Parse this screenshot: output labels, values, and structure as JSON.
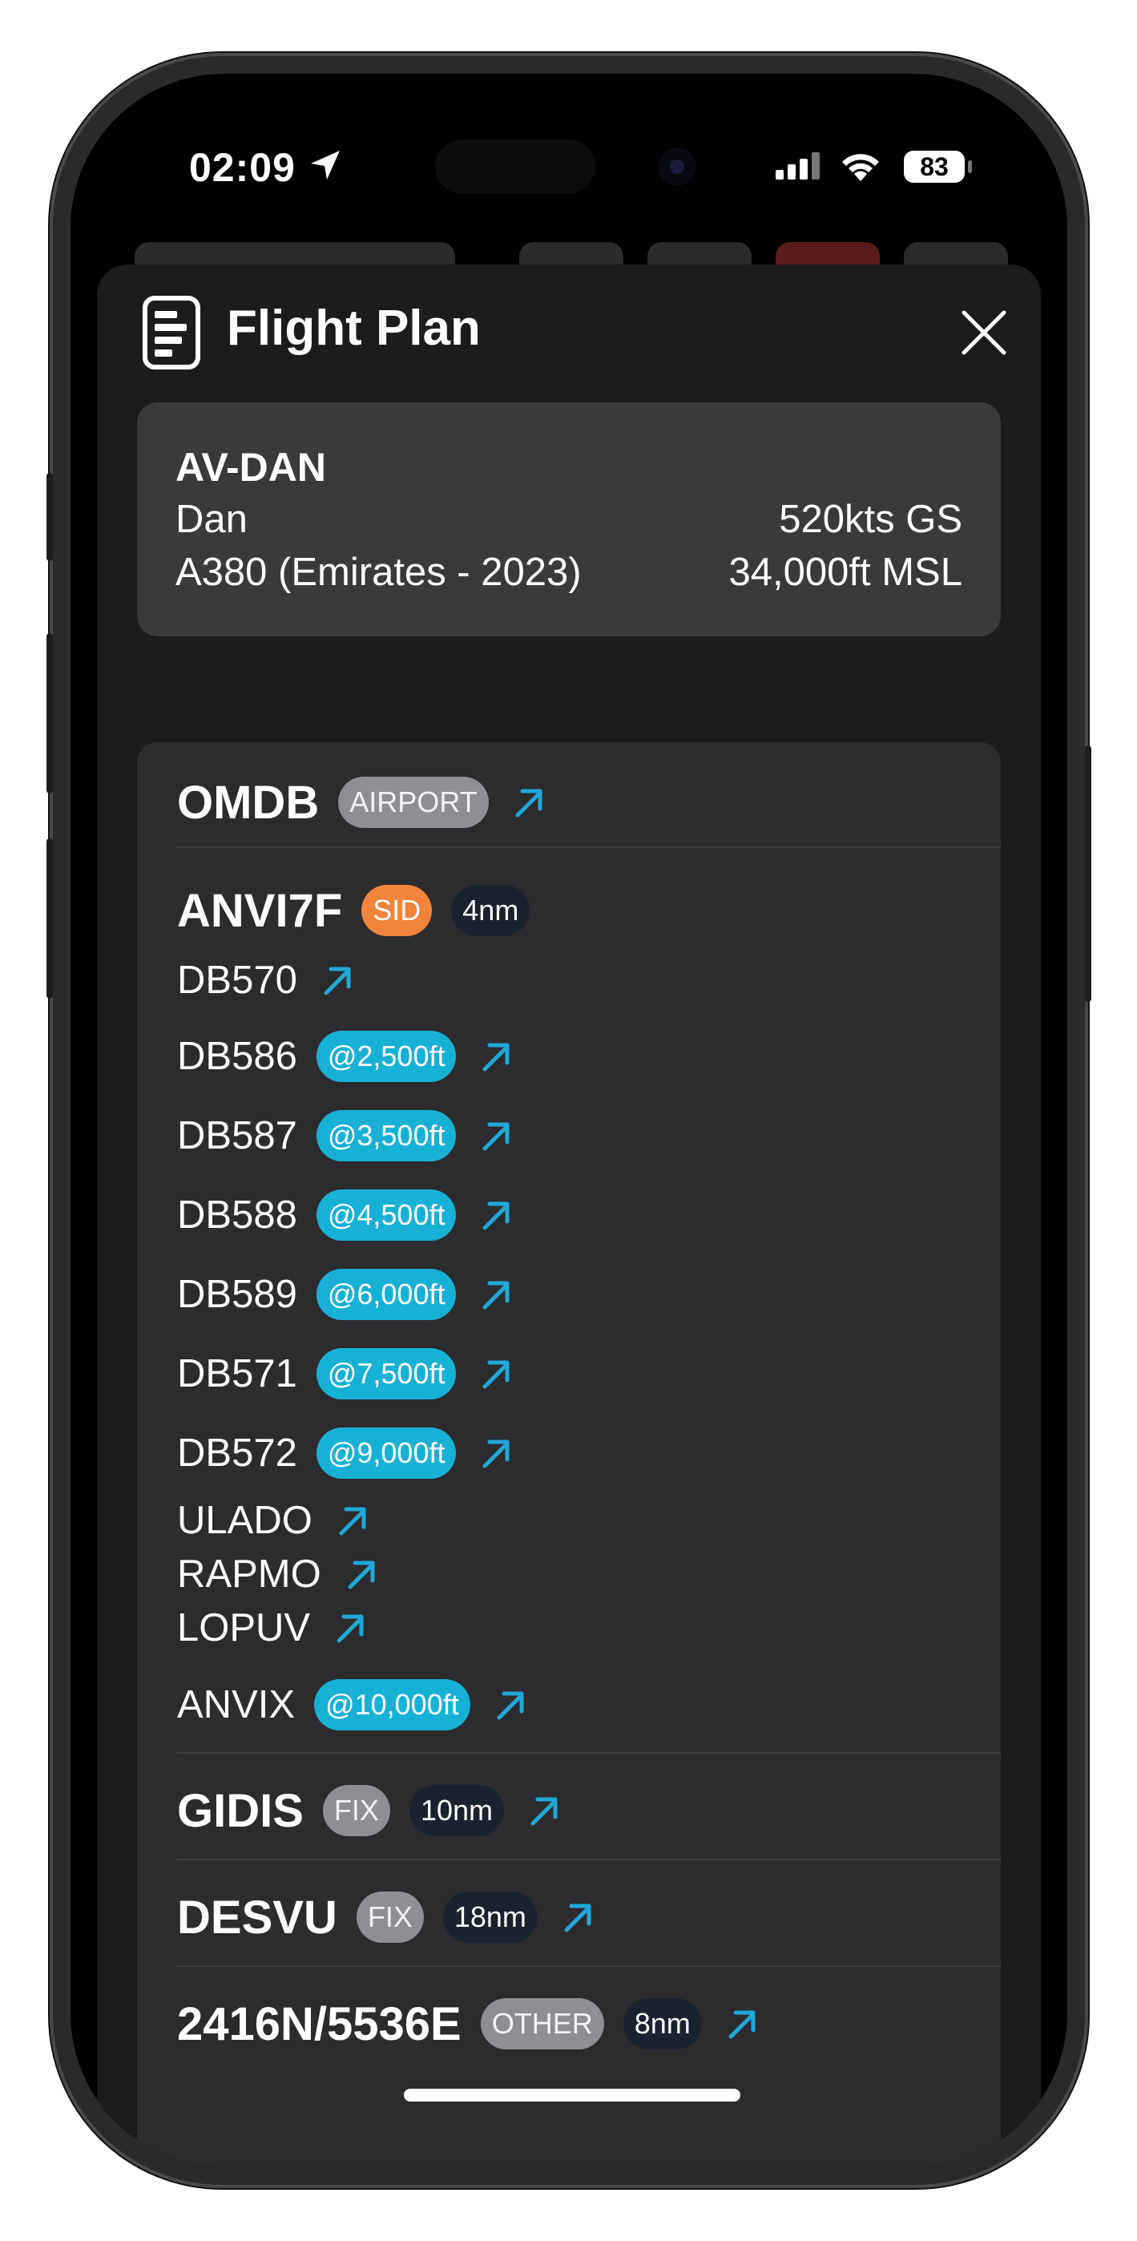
{
  "status_bar": {
    "time": "02:09",
    "battery": "83"
  },
  "sheet": {
    "title": "Flight Plan",
    "doc_icon": "document-icon",
    "close_icon": "close-icon"
  },
  "aircraft": {
    "registration": "AV-DAN",
    "pilot": "Dan",
    "speed": "520kts GS",
    "type": "A380 (Emirates - 2023)",
    "altitude": "34,000ft MSL"
  },
  "route": {
    "departure": {
      "name": "OMDB",
      "type": "AIRPORT"
    },
    "procedure": {
      "name": "ANVI7F",
      "type": "SID",
      "distance": "4nm"
    },
    "waypoints": [
      {
        "name": "DB570",
        "alt": ""
      },
      {
        "name": "DB586",
        "alt": "@2,500ft"
      },
      {
        "name": "DB587",
        "alt": "@3,500ft"
      },
      {
        "name": "DB588",
        "alt": "@4,500ft"
      },
      {
        "name": "DB589",
        "alt": "@6,000ft"
      },
      {
        "name": "DB571",
        "alt": "@7,500ft"
      },
      {
        "name": "DB572",
        "alt": "@9,000ft"
      },
      {
        "name": "ULADO",
        "alt": ""
      },
      {
        "name": "RAPMO",
        "alt": ""
      },
      {
        "name": "LOPUV",
        "alt": ""
      },
      {
        "name": "ANVIX",
        "alt": "@10,000ft"
      }
    ],
    "fixes": [
      {
        "name": "GIDIS",
        "type": "FIX",
        "distance": "10nm"
      },
      {
        "name": "DESVU",
        "type": "FIX",
        "distance": "18nm"
      },
      {
        "name": "2416N/5536E",
        "type": "OTHER",
        "distance": "8nm"
      }
    ]
  },
  "colors": {
    "accent": "#17b1d6",
    "sid": "#f2843c",
    "type_badge": "#8e8e93",
    "arrow": "#1fa8d8"
  }
}
